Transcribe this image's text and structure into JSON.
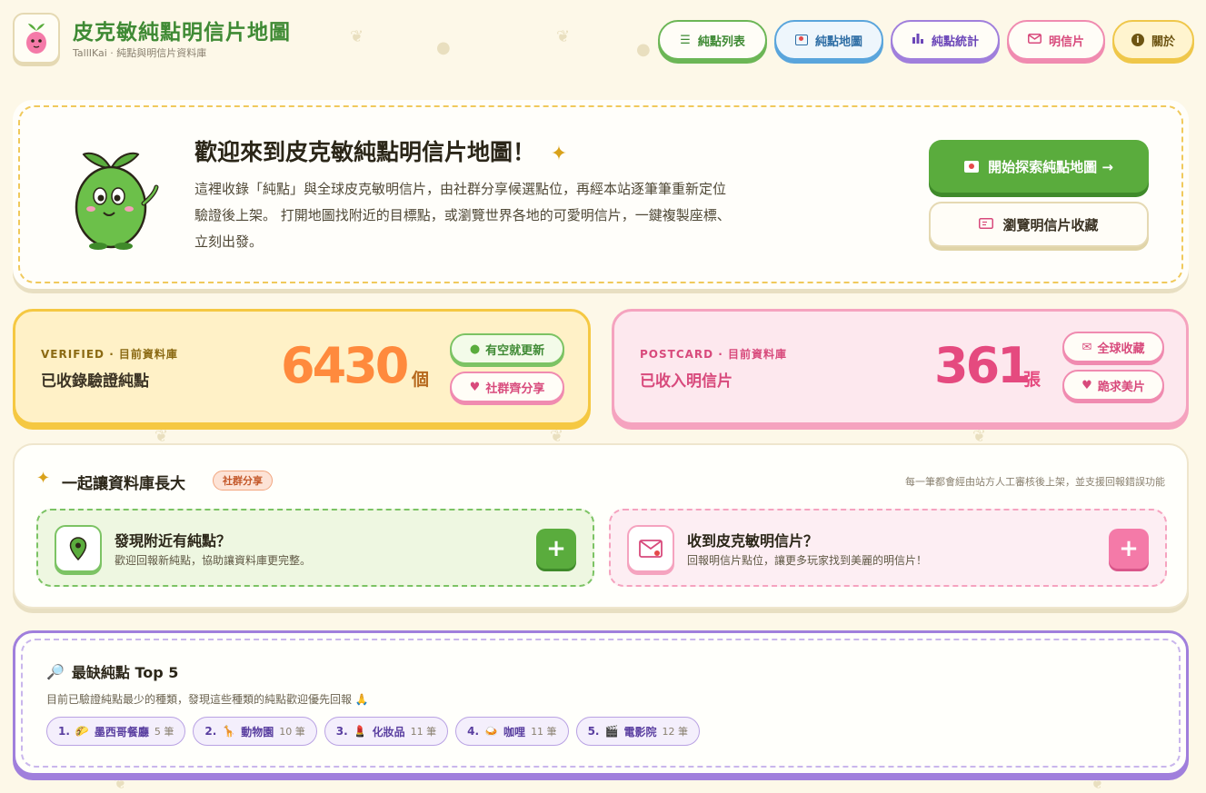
{
  "brand": {
    "title": "皮克敏純點明信片地圖",
    "subtitle": "TallIKai · 純點與明信片資料庫"
  },
  "nav": [
    {
      "label": "純點列表",
      "icon": "list-icon"
    },
    {
      "label": "純點地圖",
      "icon": "map-icon"
    },
    {
      "label": "純點統計",
      "icon": "bar-chart-icon"
    },
    {
      "label": "明信片",
      "icon": "mail-icon"
    },
    {
      "label": "關於",
      "icon": "info-icon"
    }
  ],
  "hero": {
    "title": "歡迎來到皮克敏純點明信片地圖！",
    "text": "這裡收錄「純點」與全球皮克敏明信片，由社群分享候選點位，再經本站逐筆筆重新定位驗證後上架。 打開地圖找附近的目標點，或瀏覽世界各地的可愛明信片，一鍵複製座標、立刻出發。",
    "cta_primary": "開始探索純點地圖 →",
    "cta_secondary": "瀏覽明信片收藏"
  },
  "stats": {
    "verified": {
      "kicker": "VERIFIED · 目前資料庫",
      "label": "已收錄驗證純點",
      "number": "6430",
      "unit": "個",
      "chip1": "有空就更新",
      "chip2": "社群齊分享"
    },
    "postcard": {
      "kicker": "POSTCARD · 目前資料庫",
      "label": "已收入明信片",
      "number": "361",
      "unit": "張",
      "chip1": "全球收藏",
      "chip2": "跪求美片"
    }
  },
  "contribute": {
    "title": "一起讓資料庫長大",
    "badge": "社群分享",
    "note": "每一筆都會經由站方人工審核後上架，並支援回報錯誤功能",
    "cards": [
      {
        "title": "發現附近有純點？",
        "desc": "歡迎回報新純點，協助讓資料庫更完整。"
      },
      {
        "title": "收到皮克敏明信片？",
        "desc": "回報明信片點位，讓更多玩家找到美麗的明信片！"
      }
    ],
    "plus": "+"
  },
  "top5": {
    "title": "最缺純點 Top 5",
    "subtitle": "目前已驗證純點最少的種類，發現這些種類的純點歡迎優先回報 🙏",
    "items": [
      {
        "rank": "1.",
        "emoji": "🌮",
        "name": "墨西哥餐廳",
        "count": "5 筆"
      },
      {
        "rank": "2.",
        "emoji": "🦒",
        "name": "動物園",
        "count": "10 筆"
      },
      {
        "rank": "3.",
        "emoji": "💄",
        "name": "化妝品",
        "count": "11 筆"
      },
      {
        "rank": "4.",
        "emoji": "🍛",
        "name": "咖哩",
        "count": "11 筆"
      },
      {
        "rank": "5.",
        "emoji": "🎬",
        "name": "電影院",
        "count": "12 筆"
      }
    ]
  },
  "colors": {
    "green": "#5aac3d",
    "pink": "#e54a7f",
    "orange": "#ff8a3d",
    "purple": "#a07fdc",
    "yellow": "#f5c842"
  }
}
